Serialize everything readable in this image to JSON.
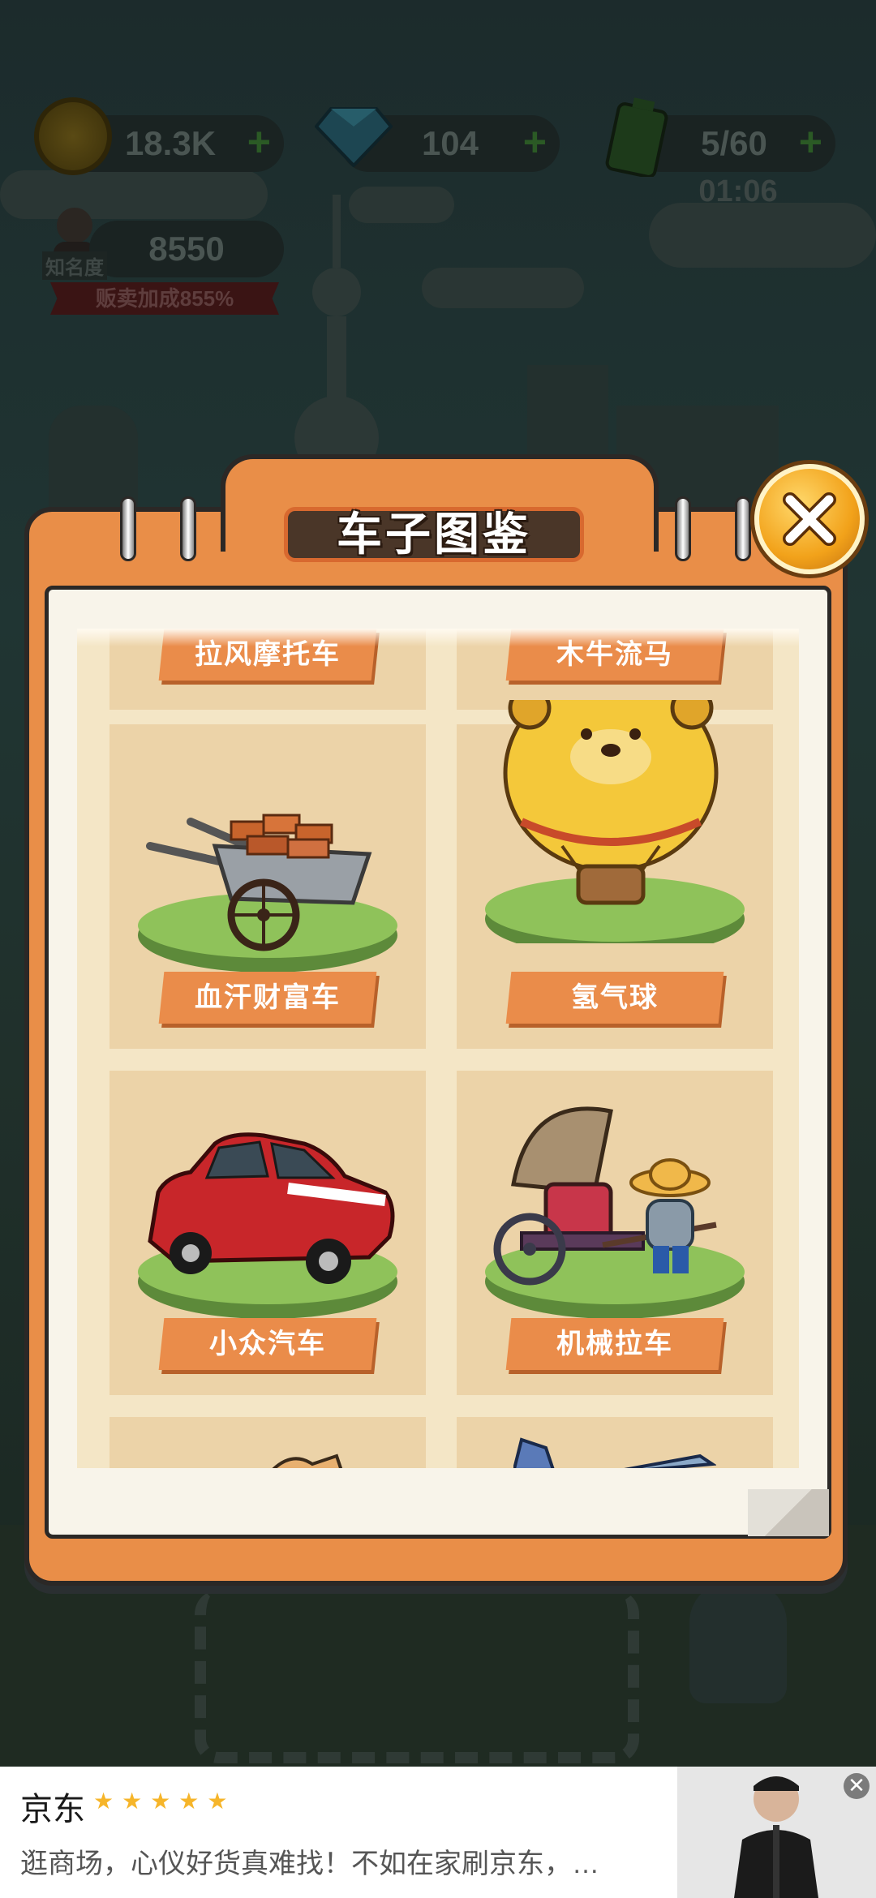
{
  "hud": {
    "coins": "18.3K",
    "gems": "104",
    "energy": "5/60",
    "energy_timer": "01:06",
    "fame_value": "8550",
    "fame_label": "知名度",
    "sell_bonus": "贩卖加成855%"
  },
  "dialog": {
    "title": "车子图鉴"
  },
  "cards": [
    {
      "label": "拉风摩托车",
      "icon": "motorcycle-icon"
    },
    {
      "label": "木牛流马",
      "icon": "wooden-ox-icon"
    },
    {
      "label": "血汗财富车",
      "icon": "brick-wheelbarrow-icon"
    },
    {
      "label": "氢气球",
      "icon": "bear-hot-air-balloon-icon"
    },
    {
      "label": "小众汽车",
      "icon": "red-car-icon"
    },
    {
      "label": "机械拉车",
      "icon": "robot-rickshaw-icon"
    }
  ],
  "ad": {
    "title": "京东",
    "stars": "★★★★★",
    "description": "逛商场，心仪好货真难找！不如在家刷京东，…",
    "close_symbol": "✕"
  },
  "colors": {
    "dialog_orange": "#e98e48",
    "card_bg": "#ecd3a8",
    "label_orange": "#ea8c4a",
    "close_gold": "#f2a21a",
    "star_yellow": "#f6b52a"
  }
}
